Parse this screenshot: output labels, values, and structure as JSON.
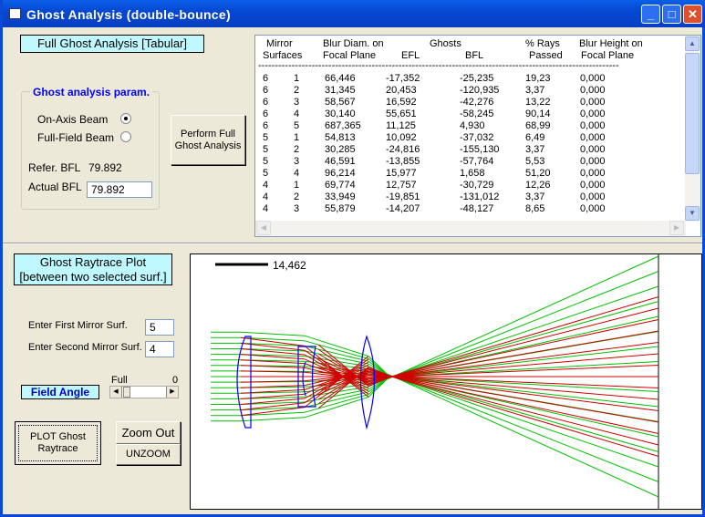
{
  "window": {
    "title": "Ghost  Analysis  (double-bounce)",
    "controls": [
      "minimize",
      "maximize",
      "close"
    ]
  },
  "tabular": {
    "header_label": "Full Ghost Analysis  [Tabular]",
    "group_title": "Ghost analysis param.",
    "on_axis_label": "On-Axis   Beam",
    "full_field_label": "Full-Field Beam",
    "selected": "on-axis",
    "refer_bfl_label": "Refer. BFL",
    "refer_bfl_value": "79.892",
    "actual_bfl_label": "Actual BFL",
    "actual_bfl_value": "79.892",
    "perform_button": [
      "Perform Full",
      "Ghost Analysis"
    ]
  },
  "table": {
    "headers": {
      "mirror": "Mirror",
      "surfaces": "Surfaces",
      "blur1": "Blur Diam. on",
      "blur2": "Focal Plane",
      "ghosts": "Ghosts",
      "efl": "EFL",
      "bfl": "BFL",
      "rays1": "% Rays",
      "rays2": "Passed",
      "height1": "Blur Height on",
      "height2": "Focal Plane"
    },
    "separator": "------------------------------------------------------------------------------------------------------------",
    "rows": [
      [
        "6",
        "1",
        "66,446",
        "-17,352",
        "-25,235",
        "19,23",
        "0,000"
      ],
      [
        "6",
        "2",
        "31,345",
        "20,453",
        "-120,935",
        "3,37",
        "0,000"
      ],
      [
        "6",
        "3",
        "58,567",
        "16,592",
        "-42,276",
        "13,22",
        "0,000"
      ],
      [
        "6",
        "4",
        "30,140",
        "55,651",
        "-58,245",
        "90,14",
        "0,000"
      ],
      [
        "6",
        "5",
        "687,365",
        "11,125",
        "4,930",
        "68,99",
        "0,000"
      ],
      [
        "5",
        "1",
        "54,813",
        "10,092",
        "-37,032",
        "6,49",
        "0,000"
      ],
      [
        "5",
        "2",
        "30,285",
        "-24,816",
        "-155,130",
        "3,37",
        "0,000"
      ],
      [
        "5",
        "3",
        "46,591",
        "-13,855",
        "-57,764",
        "5,53",
        "0,000"
      ],
      [
        "5",
        "4",
        "96,214",
        "15,977",
        "1,658",
        "51,20",
        "0,000"
      ],
      [
        "4",
        "1",
        "69,774",
        "12,757",
        "-30,729",
        "12,26",
        "0,000"
      ],
      [
        "4",
        "2",
        "33,949",
        "-19,851",
        "-131,012",
        "3,37",
        "0,000"
      ],
      [
        "4",
        "3",
        "55,879",
        "-14,207",
        "-48,127",
        "8,65",
        "0,000"
      ]
    ]
  },
  "raytrace": {
    "header_line1": "Ghost  Raytrace  Plot",
    "header_line2": "[between two selected surf.]",
    "first_label": "Enter First  Mirror Surf.",
    "first_value": "5",
    "second_label": "Enter Second Mirror Surf.",
    "second_value": "4",
    "field_angle_label": "Field Angle",
    "slider_left": "Full",
    "slider_right": "0",
    "slider_position": 0.05,
    "plot_button": [
      "PLOT Ghost",
      "Raytrace"
    ],
    "zoom_out": "Zoom Out",
    "unzoom": "UNZOOM",
    "scale_label": "14,462",
    "colors": {
      "lens": "#0000ff",
      "primary_rays": "#00c000",
      "ghost_rays": "#d00000"
    }
  }
}
